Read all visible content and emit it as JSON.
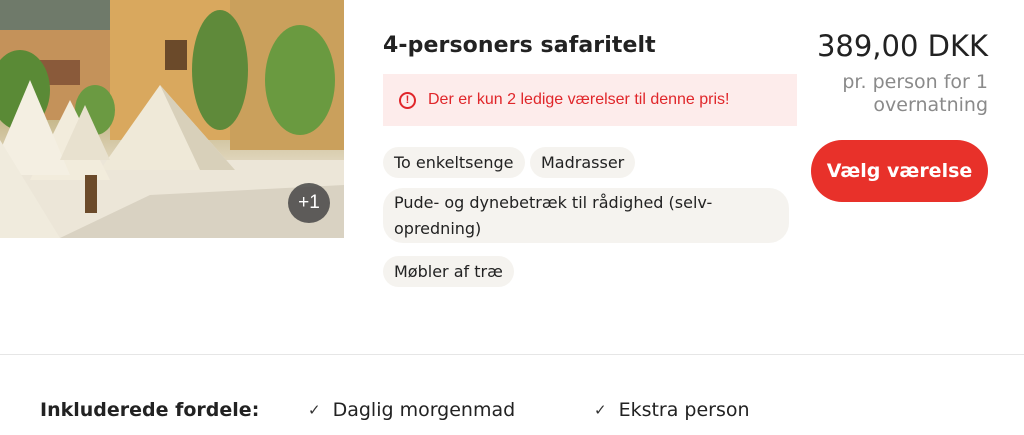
{
  "photo": {
    "more_count": "+1",
    "more_icon": "photo-gallery-count"
  },
  "room": {
    "title": "4-personers safaritelt"
  },
  "alert": {
    "icon": "exclamation-circle-icon",
    "text": "Der er kun 2 ledige værelser til denne pris!",
    "color": "#e0262a",
    "background": "#fdeceb"
  },
  "amenities": [
    "To enkeltsenge",
    "Madrasser",
    "Pude- og dynebetræk til rådighed (selv-opredning)",
    "Møbler af træ"
  ],
  "pricing": {
    "price": "389,00 DKK",
    "note": "pr. person for 1 overnatning"
  },
  "actions": {
    "select_label": "Vælg værelse",
    "select_color": "#e8312a"
  },
  "benefits": {
    "label": "Inkluderede fordele:",
    "items": [
      "Daglig morgenmad",
      "Ekstra person"
    ]
  }
}
